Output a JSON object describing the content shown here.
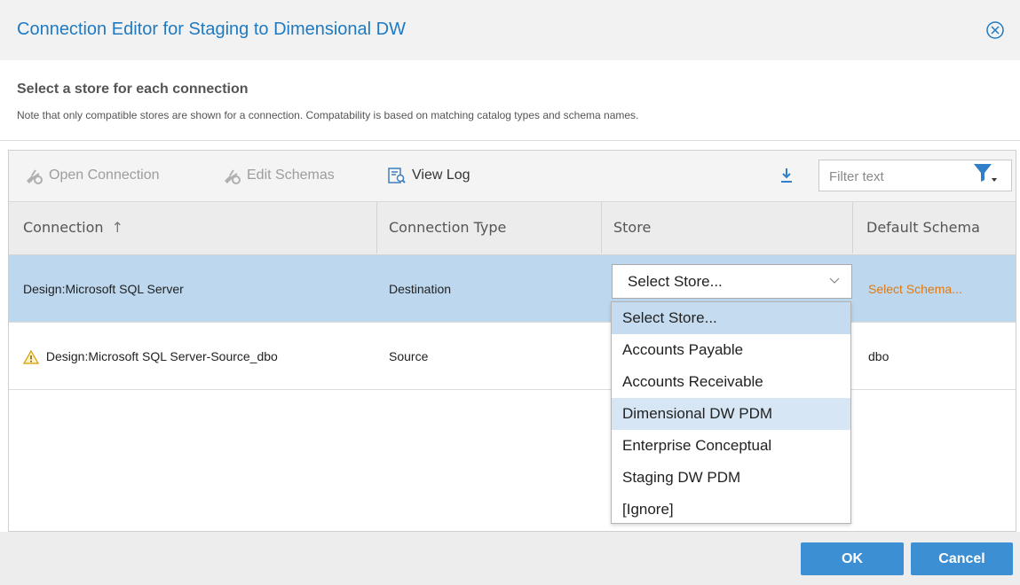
{
  "dialog": {
    "title": "Connection Editor for Staging to Dimensional DW",
    "heading": "Select a store for each connection",
    "note": "Note that only compatible stores are shown for a connection. Compatability is based on matching catalog types and schema names."
  },
  "toolbar": {
    "open_connection": "Open Connection",
    "edit_schemas": "Edit Schemas",
    "view_log": "View Log",
    "filter_placeholder": "Filter text"
  },
  "columns": {
    "connection": "Connection",
    "connection_type": "Connection Type",
    "store": "Store",
    "default_schema": "Default Schema",
    "sort_indicator": "↑"
  },
  "rows": [
    {
      "connection": "Design:Microsoft SQL Server",
      "type": "Destination",
      "store": "Select Store...",
      "schema": "Select Schema...",
      "selected": true
    },
    {
      "connection": "Design:Microsoft SQL Server-Source_dbo",
      "type": "Source",
      "store": "",
      "schema": "dbo",
      "warning": true
    }
  ],
  "store_options": [
    "Select Store...",
    "Accounts Payable",
    "Accounts Receivable",
    "Dimensional DW PDM",
    "Enterprise Conceptual",
    "Staging DW PDM",
    "[Ignore]"
  ],
  "buttons": {
    "ok": "OK",
    "cancel": "Cancel"
  },
  "colors": {
    "title": "#1f7ac2",
    "selected_row": "#bcd7ee",
    "link": "#e07a10",
    "button": "#3d8fd4"
  }
}
